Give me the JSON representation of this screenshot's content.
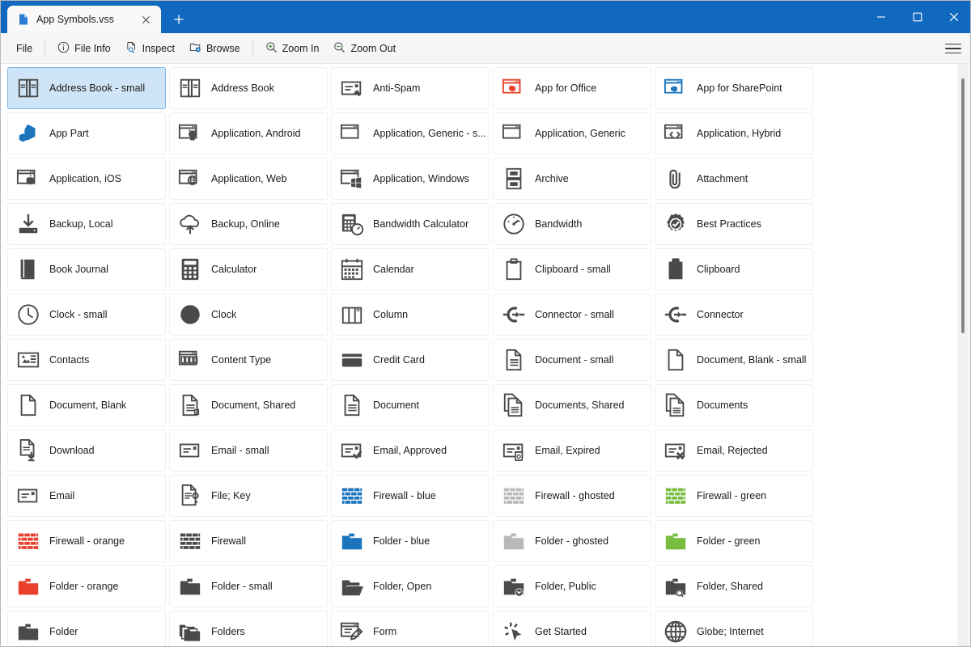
{
  "window": {
    "tab": {
      "title": "App Symbols.vss",
      "icon": "file-icon",
      "close_icon": "close-icon"
    },
    "new_tab_icon": "plus-icon",
    "controls": {
      "minimize": "minimize-icon",
      "maximize": "maximize-icon",
      "close": "close-icon"
    },
    "accent_color": "#1068bf"
  },
  "toolbar": {
    "file_label": "File",
    "items": [
      {
        "label": "File Info",
        "icon": "info-circle-icon"
      },
      {
        "label": "Inspect",
        "icon": "inspect-page-icon"
      },
      {
        "label": "Browse",
        "icon": "browse-folder-icon"
      },
      {
        "label": "Zoom In",
        "icon": "zoom-in-icon"
      },
      {
        "label": "Zoom Out",
        "icon": "zoom-out-icon"
      }
    ],
    "menu_icon": "hamburger-icon"
  },
  "scrollbar": {
    "orientation": "vertical",
    "thumb_top_pct": 2.5,
    "thumb_height_pct": 44
  },
  "colors": {
    "selection_bg": "#cfe4f7",
    "selection_border": "#7fb3e0",
    "icon_dark": "#4a4a4a",
    "icon_blue": "#1b74bc",
    "icon_orange": "#e8402a",
    "icon_green": "#78bd40",
    "icon_ghost": "#b9b9b9"
  },
  "grid": {
    "columns": 5,
    "selected_index": 0,
    "items": [
      {
        "label": "Address Book - small",
        "icon": "address-book-small-icon",
        "color": "dark"
      },
      {
        "label": "Address Book",
        "icon": "address-book-icon",
        "color": "dark"
      },
      {
        "label": "Anti-Spam",
        "icon": "anti-spam-icon",
        "color": "dark"
      },
      {
        "label": "App for Office",
        "icon": "app-for-office-icon",
        "color": "orange"
      },
      {
        "label": "App for SharePoint",
        "icon": "app-for-sharepoint-icon",
        "color": "blue"
      },
      {
        "label": "App Part",
        "icon": "app-part-icon",
        "color": "blue"
      },
      {
        "label": "Application, Android",
        "icon": "application-android-icon",
        "color": "dark"
      },
      {
        "label": "Application, Generic - s...",
        "icon": "application-generic-small-icon",
        "color": "dark"
      },
      {
        "label": "Application, Generic",
        "icon": "application-generic-icon",
        "color": "dark"
      },
      {
        "label": "Application, Hybrid",
        "icon": "application-hybrid-icon",
        "color": "dark"
      },
      {
        "label": "Application, iOS",
        "icon": "application-ios-icon",
        "color": "dark"
      },
      {
        "label": "Application, Web",
        "icon": "application-web-icon",
        "color": "dark"
      },
      {
        "label": "Application, Windows",
        "icon": "application-windows-icon",
        "color": "dark"
      },
      {
        "label": "Archive",
        "icon": "archive-icon",
        "color": "dark"
      },
      {
        "label": "Attachment",
        "icon": "attachment-icon",
        "color": "dark"
      },
      {
        "label": "Backup, Local",
        "icon": "backup-local-icon",
        "color": "dark"
      },
      {
        "label": "Backup, Online",
        "icon": "backup-online-icon",
        "color": "dark"
      },
      {
        "label": "Bandwidth Calculator",
        "icon": "bandwidth-calculator-icon",
        "color": "dark"
      },
      {
        "label": "Bandwidth",
        "icon": "bandwidth-icon",
        "color": "dark"
      },
      {
        "label": "Best Practices",
        "icon": "best-practices-icon",
        "color": "dark"
      },
      {
        "label": "Book Journal",
        "icon": "book-journal-icon",
        "color": "dark"
      },
      {
        "label": "Calculator",
        "icon": "calculator-icon",
        "color": "dark"
      },
      {
        "label": "Calendar",
        "icon": "calendar-icon",
        "color": "dark"
      },
      {
        "label": "Clipboard - small",
        "icon": "clipboard-small-icon",
        "color": "dark"
      },
      {
        "label": "Clipboard",
        "icon": "clipboard-icon",
        "color": "dark"
      },
      {
        "label": "Clock - small",
        "icon": "clock-small-icon",
        "color": "dark"
      },
      {
        "label": "Clock",
        "icon": "clock-icon",
        "color": "dark"
      },
      {
        "label": "Column",
        "icon": "column-icon",
        "color": "dark"
      },
      {
        "label": "Connector - small",
        "icon": "connector-small-icon",
        "color": "dark"
      },
      {
        "label": "Connector",
        "icon": "connector-icon",
        "color": "dark"
      },
      {
        "label": "Contacts",
        "icon": "contacts-icon",
        "color": "dark"
      },
      {
        "label": "Content Type",
        "icon": "content-type-icon",
        "color": "dark"
      },
      {
        "label": "Credit Card",
        "icon": "credit-card-icon",
        "color": "dark"
      },
      {
        "label": "Document - small",
        "icon": "document-small-icon",
        "color": "dark"
      },
      {
        "label": "Document, Blank - small",
        "icon": "document-blank-small-icon",
        "color": "dark"
      },
      {
        "label": "Document, Blank",
        "icon": "document-blank-icon",
        "color": "dark"
      },
      {
        "label": "Document, Shared",
        "icon": "document-shared-icon",
        "color": "dark"
      },
      {
        "label": "Document",
        "icon": "document-icon",
        "color": "dark"
      },
      {
        "label": "Documents, Shared",
        "icon": "documents-shared-icon",
        "color": "dark"
      },
      {
        "label": "Documents",
        "icon": "documents-icon",
        "color": "dark"
      },
      {
        "label": "Download",
        "icon": "download-icon",
        "color": "dark"
      },
      {
        "label": "Email - small",
        "icon": "email-small-icon",
        "color": "dark"
      },
      {
        "label": "Email, Approved",
        "icon": "email-approved-icon",
        "color": "dark"
      },
      {
        "label": "Email, Expired",
        "icon": "email-expired-icon",
        "color": "dark"
      },
      {
        "label": "Email, Rejected",
        "icon": "email-rejected-icon",
        "color": "dark"
      },
      {
        "label": "Email",
        "icon": "email-icon",
        "color": "dark"
      },
      {
        "label": "File; Key",
        "icon": "file-key-icon",
        "color": "dark"
      },
      {
        "label": "Firewall - blue",
        "icon": "firewall-blue-icon",
        "color": "blue"
      },
      {
        "label": "Firewall - ghosted",
        "icon": "firewall-ghosted-icon",
        "color": "ghost"
      },
      {
        "label": "Firewall - green",
        "icon": "firewall-green-icon",
        "color": "green"
      },
      {
        "label": "Firewall - orange",
        "icon": "firewall-orange-icon",
        "color": "orange"
      },
      {
        "label": "Firewall",
        "icon": "firewall-icon",
        "color": "dark"
      },
      {
        "label": "Folder - blue",
        "icon": "folder-blue-icon",
        "color": "blue"
      },
      {
        "label": "Folder - ghosted",
        "icon": "folder-ghosted-icon",
        "color": "ghost"
      },
      {
        "label": "Folder - green",
        "icon": "folder-green-icon",
        "color": "green"
      },
      {
        "label": "Folder - orange",
        "icon": "folder-orange-icon",
        "color": "orange"
      },
      {
        "label": "Folder - small",
        "icon": "folder-small-icon",
        "color": "dark"
      },
      {
        "label": "Folder, Open",
        "icon": "folder-open-icon",
        "color": "dark"
      },
      {
        "label": "Folder, Public",
        "icon": "folder-public-icon",
        "color": "dark"
      },
      {
        "label": "Folder, Shared",
        "icon": "folder-shared-icon",
        "color": "dark"
      },
      {
        "label": "Folder",
        "icon": "folder-icon",
        "color": "dark"
      },
      {
        "label": "Folders",
        "icon": "folders-icon",
        "color": "dark"
      },
      {
        "label": "Form",
        "icon": "form-icon",
        "color": "dark"
      },
      {
        "label": "Get Started",
        "icon": "get-started-icon",
        "color": "dark"
      },
      {
        "label": "Globe; Internet",
        "icon": "globe-internet-icon",
        "color": "dark"
      }
    ]
  }
}
